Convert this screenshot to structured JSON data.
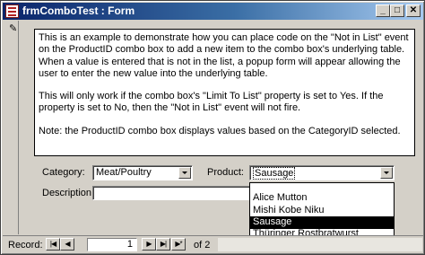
{
  "window": {
    "title": "frmComboTest : Form",
    "minimize_glyph": "_",
    "maximize_glyph": "□",
    "close_glyph": "✕"
  },
  "note": {
    "paragraphs": [
      "This is an example to demonstrate how you can place code on the \"Not in List\" event on the ProductID combo box to add a new item to the combo box's underlying table.  When a value is entered that is not in the list, a popup form will appear allowing the user to enter the new value into the underlying table.",
      "This will only work if the combo box's \"Limit To List\" property is set to Yes.  If the property is set to No, then the \"Not in List\" event will not fire.",
      "Note: the ProductID combo box displays values based on the CategoryID selected."
    ]
  },
  "fields": {
    "category_label": "Category:",
    "category_value": "Meat/Poultry",
    "product_label": "Product:",
    "product_value": "Sausage",
    "description_label": "Description:",
    "description_value": ""
  },
  "product_list": {
    "items": [
      "",
      "Alice Mutton",
      "Mishi Kobe Niku",
      "Sausage",
      "Thüringer Rostbratwurst"
    ],
    "selected": "Sausage"
  },
  "record_nav": {
    "label": "Record:",
    "current": "1",
    "of_text": "of  2",
    "first_glyph": "|◀",
    "prev_glyph": "◀",
    "next_glyph": "▶",
    "last_glyph": "▶|",
    "new_glyph": "▶*"
  }
}
